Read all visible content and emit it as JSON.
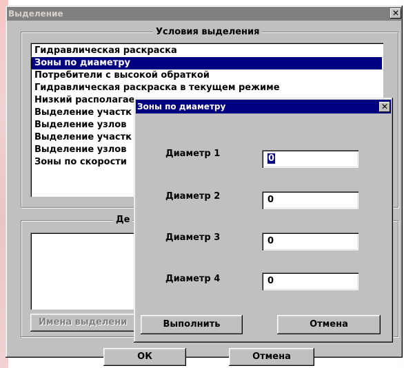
{
  "main_dialog": {
    "title": "Выделение",
    "close_glyph": "✕",
    "conditions_group": {
      "caption": "Условия выделения",
      "items": [
        {
          "label": "Гидравлическая раскраска",
          "selected": false
        },
        {
          "label": "Зоны по диаметру",
          "selected": true
        },
        {
          "label": "Потребители с высокой обраткой",
          "selected": false
        },
        {
          "label": "Гидравлическая раскраска в текущем режиме",
          "selected": false
        },
        {
          "label": "Низкий располагае",
          "selected": false
        },
        {
          "label": "Выделение участк",
          "selected": false
        },
        {
          "label": "Выделение узлов",
          "selected": false
        },
        {
          "label": "Выделение участк",
          "selected": false
        },
        {
          "label": "Выделение узлов",
          "selected": false
        },
        {
          "label": "Зоны по скорости",
          "selected": false
        }
      ]
    },
    "actions_group": {
      "caption": "Де",
      "names_button": "Имена выделени"
    },
    "ok_button": "ОК",
    "cancel_button": "Отмена"
  },
  "child_dialog": {
    "title": "Зоны по диаметру",
    "close_glyph": "✕",
    "fields": [
      {
        "label": "Диаметр 1",
        "value": "0"
      },
      {
        "label": "Диаметр 2",
        "value": "0"
      },
      {
        "label": "Диаметр 3",
        "value": "0"
      },
      {
        "label": "Диаметр 4",
        "value": "0"
      }
    ],
    "execute_button": "Выполнить",
    "cancel_button": "Отмена"
  },
  "colors": {
    "face": "#c0c0c0",
    "active_title": "#000080",
    "inactive_title": "#808080",
    "selection": "#000080"
  }
}
